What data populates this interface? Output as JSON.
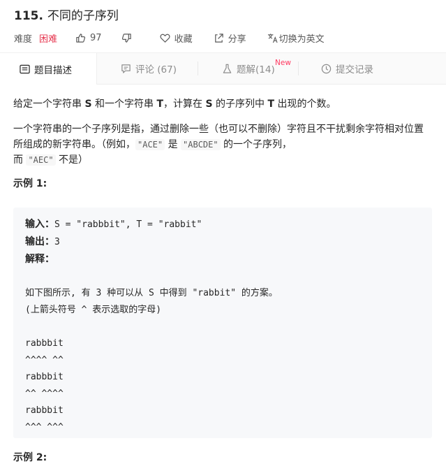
{
  "problem": {
    "number": "115.",
    "name": "不同的子序列",
    "difficulty_label": "难度",
    "difficulty": "困难",
    "likes": "97",
    "actions": {
      "collect": "收藏",
      "share": "分享",
      "switch_lang": "切换为英文"
    }
  },
  "tabs": [
    {
      "label": "题目描述"
    },
    {
      "label": "评论 (67)"
    },
    {
      "label": "题解(14)",
      "badge": "New"
    },
    {
      "label": "提交记录"
    }
  ],
  "description": {
    "p1": [
      "给定一个字符串 ",
      "S",
      " 和一个字符串 ",
      "T",
      "，计算在 ",
      "S",
      " 的子序列中 ",
      "T",
      " 出现的个数。"
    ],
    "p2": [
      "一个字符串的一个子序列是指，通过删除一些（也可以不删除）字符且不干扰剩余字符相对位置所组成的新字符串。（例如，",
      "\"ACE\"",
      " 是 ",
      "\"ABCDE\"",
      " 的一个子序列，",
      "而 ",
      "\"AEC\"",
      " 不是）"
    ],
    "example1_title": "示例 1:",
    "example1": {
      "input_label": "输入：",
      "input": "S = \"rabbbit\", T = \"rabbit\"",
      "output_label": "输出：",
      "output": "3",
      "explain_label": "解释：",
      "lines": [
        "",
        "如下图所示, 有 3 种可以从 S 中得到 \"rabbit\" 的方案。",
        "(上箭头符号 ^ 表示选取的字母)",
        "",
        "rabbbit",
        "^^^^ ^^",
        "rabbbit",
        "^^ ^^^^",
        "rabbbit",
        "^^^ ^^^"
      ]
    },
    "example2_title": "示例 2:"
  },
  "colors": {
    "difficulty_hard": "#e6364f",
    "new_badge": "#ff3860"
  },
  "icons": [
    "thumb-up-icon",
    "thumb-down-icon",
    "heart-icon",
    "share-icon",
    "translate-icon",
    "document-icon",
    "comment-icon",
    "flask-icon",
    "clock-icon"
  ]
}
